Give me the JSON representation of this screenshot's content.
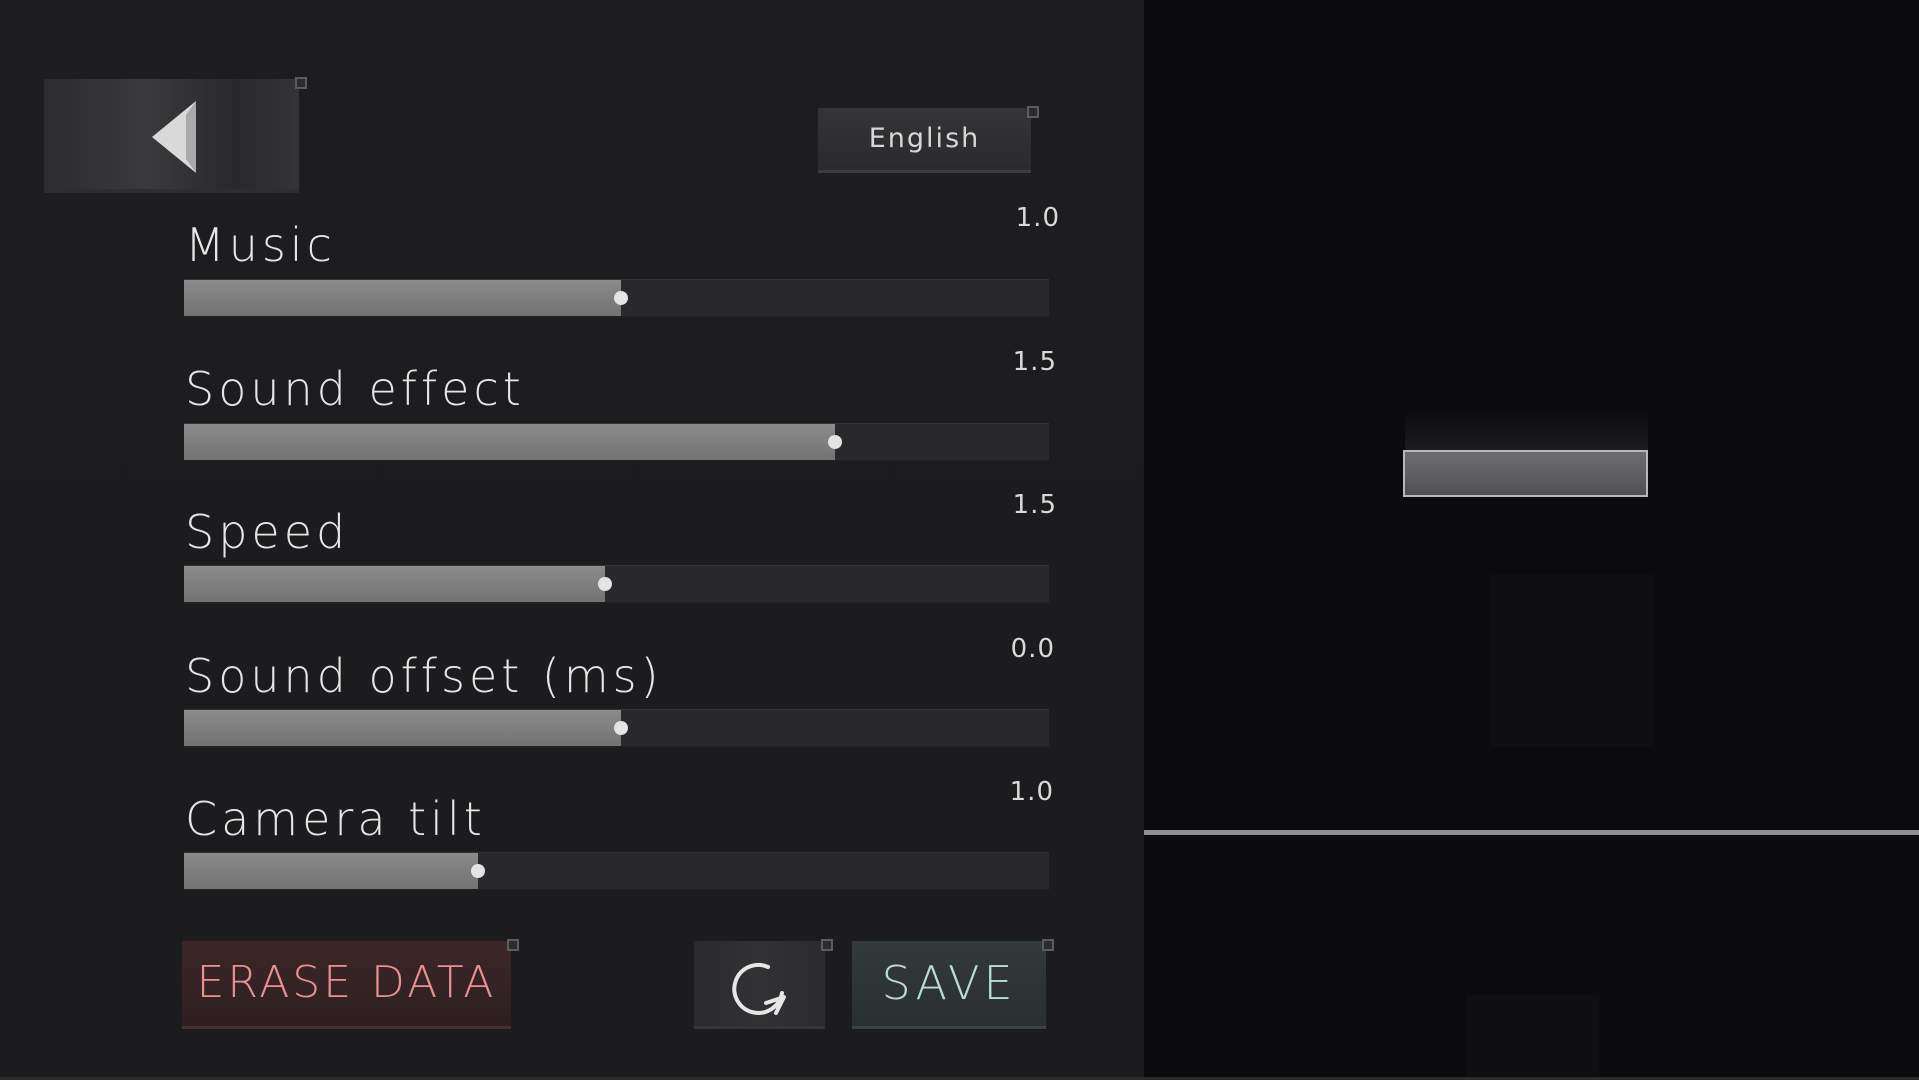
{
  "settings": {
    "language_label": "English",
    "sliders": [
      {
        "label": "Music",
        "value_text": "1.0",
        "fill_fraction": 0.505
      },
      {
        "label": "Sound effect",
        "value_text": "1.5",
        "fill_fraction": 0.753
      },
      {
        "label": "Speed",
        "value_text": "1.5",
        "fill_fraction": 0.487
      },
      {
        "label": "Sound offset (ms)",
        "value_text": "0.0",
        "fill_fraction": 0.505
      },
      {
        "label": "Camera tilt",
        "value_text": "1.0",
        "fill_fraction": 0.34
      }
    ],
    "erase_label": "ERASE DATA",
    "save_label": "SAVE"
  },
  "icons": {
    "back": "back-arrow-icon",
    "reset": "reset-icon"
  },
  "colors": {
    "erase_text": "#e79290",
    "save_text": "#b9dcd9",
    "slider_fill": "#808080",
    "slider_knob": "#e4e4e4"
  }
}
